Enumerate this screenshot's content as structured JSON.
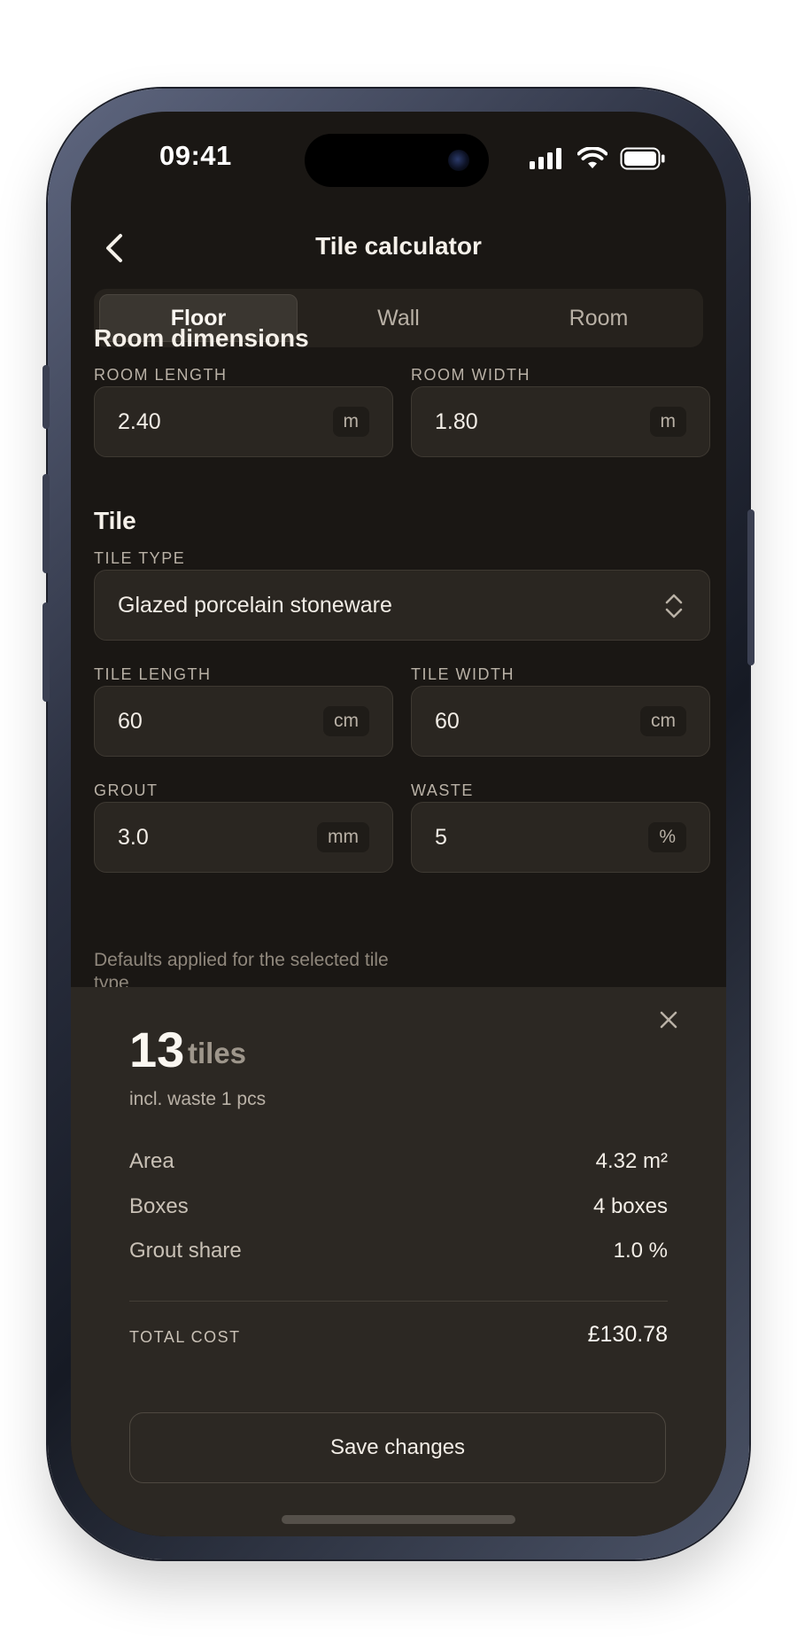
{
  "status_bar": {
    "time": "09:41"
  },
  "nav": {
    "title": "Tile calculator"
  },
  "tabs": [
    {
      "label": "Floor",
      "active": true
    },
    {
      "label": "Wall",
      "active": false
    },
    {
      "label": "Room",
      "active": false
    }
  ],
  "room": {
    "section_title": "Room dimensions",
    "length": {
      "label": "ROOM LENGTH",
      "value": "2.40",
      "unit": "m"
    },
    "width": {
      "label": "ROOM WIDTH",
      "value": "1.80",
      "unit": "m"
    }
  },
  "tile": {
    "section_title": "Tile",
    "type": {
      "label": "TILE TYPE",
      "value": "Glazed porcelain stoneware"
    },
    "length": {
      "label": "TILE LENGTH",
      "value": "60",
      "unit": "cm"
    },
    "width": {
      "label": "TILE WIDTH",
      "value": "60",
      "unit": "cm"
    },
    "grout": {
      "label": "GROUT",
      "value": "3.0",
      "unit": "mm"
    },
    "waste": {
      "label": "WASTE",
      "value": "5",
      "unit": "%"
    },
    "hint": "Defaults applied for the selected tile type"
  },
  "result": {
    "count": "13",
    "count_unit": "tiles",
    "subtitle": "incl. waste 1 pcs",
    "rows": [
      {
        "label": "Area",
        "value": "4.32 m²"
      },
      {
        "label": "Boxes",
        "value": "4 boxes"
      },
      {
        "label": "Grout share",
        "value": "1.0 %"
      }
    ],
    "total_label": "TOTAL COST",
    "total_value": "£130.78",
    "save_label": "Save changes"
  },
  "colors": {
    "background": "#1a1714",
    "sheet": "#2c2823",
    "field": "#2a2621",
    "text": "#f2ede6",
    "muted": "#b9b1a6"
  },
  "icons": [
    "back-chevron-icon",
    "signal-icon",
    "wifi-icon",
    "battery-icon",
    "chevron-updown-icon",
    "close-icon"
  ]
}
